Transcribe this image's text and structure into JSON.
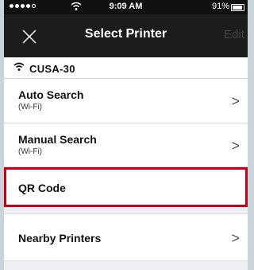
{
  "status_bar": {
    "time": "9:09 AM",
    "battery": "91%"
  },
  "nav": {
    "title": "Select Printer",
    "edit_label": "Edit"
  },
  "network": {
    "name": "CUSA-30"
  },
  "rows": [
    {
      "title": "Auto Search",
      "subtitle": "(Wi-Fi)",
      "chevron": ">"
    },
    {
      "title": "Manual Search",
      "subtitle": "(Wi-Fi)",
      "chevron": ">"
    },
    {
      "title": "QR Code",
      "subtitle": "",
      "chevron": ""
    },
    {
      "title": "Nearby Printers",
      "subtitle": "",
      "chevron": ">"
    }
  ],
  "colors": {
    "highlight": "#c7001a",
    "nav_background": "#1c1c1c"
  }
}
